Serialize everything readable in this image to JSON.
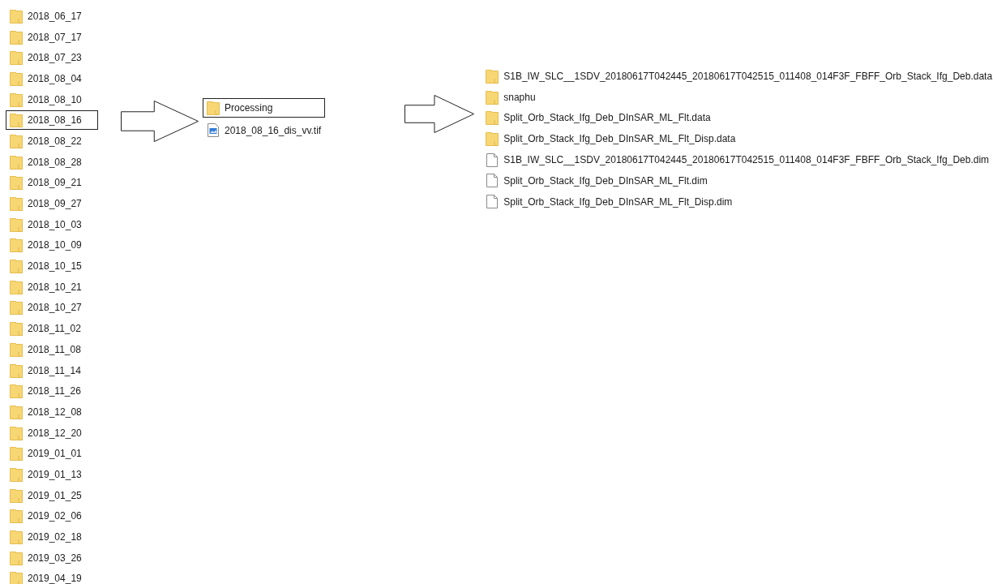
{
  "panes": [
    {
      "items": [
        {
          "name": "2018_06_17",
          "kind": "folder",
          "selected": false
        },
        {
          "name": "2018_07_17",
          "kind": "folder",
          "selected": false
        },
        {
          "name": "2018_07_23",
          "kind": "folder",
          "selected": false
        },
        {
          "name": "2018_08_04",
          "kind": "folder",
          "selected": false
        },
        {
          "name": "2018_08_10",
          "kind": "folder",
          "selected": false
        },
        {
          "name": "2018_08_16",
          "kind": "folder",
          "selected": true
        },
        {
          "name": "2018_08_22",
          "kind": "folder",
          "selected": false
        },
        {
          "name": "2018_08_28",
          "kind": "folder",
          "selected": false
        },
        {
          "name": "2018_09_21",
          "kind": "folder",
          "selected": false
        },
        {
          "name": "2018_09_27",
          "kind": "folder",
          "selected": false
        },
        {
          "name": "2018_10_03",
          "kind": "folder",
          "selected": false
        },
        {
          "name": "2018_10_09",
          "kind": "folder",
          "selected": false
        },
        {
          "name": "2018_10_15",
          "kind": "folder",
          "selected": false
        },
        {
          "name": "2018_10_21",
          "kind": "folder",
          "selected": false
        },
        {
          "name": "2018_10_27",
          "kind": "folder",
          "selected": false
        },
        {
          "name": "2018_11_02",
          "kind": "folder",
          "selected": false
        },
        {
          "name": "2018_11_08",
          "kind": "folder",
          "selected": false
        },
        {
          "name": "2018_11_14",
          "kind": "folder",
          "selected": false
        },
        {
          "name": "2018_11_26",
          "kind": "folder",
          "selected": false
        },
        {
          "name": "2018_12_08",
          "kind": "folder",
          "selected": false
        },
        {
          "name": "2018_12_20",
          "kind": "folder",
          "selected": false
        },
        {
          "name": "2019_01_01",
          "kind": "folder",
          "selected": false
        },
        {
          "name": "2019_01_13",
          "kind": "folder",
          "selected": false
        },
        {
          "name": "2019_01_25",
          "kind": "folder",
          "selected": false
        },
        {
          "name": "2019_02_06",
          "kind": "folder",
          "selected": false
        },
        {
          "name": "2019_02_18",
          "kind": "folder",
          "selected": false
        },
        {
          "name": "2019_03_26",
          "kind": "folder",
          "selected": false
        },
        {
          "name": "2019_04_19",
          "kind": "folder",
          "selected": false
        }
      ]
    },
    {
      "items": [
        {
          "name": "Processing",
          "kind": "folder",
          "selected": true
        },
        {
          "name": "2018_08_16_dis_vv.tif",
          "kind": "image",
          "selected": false
        }
      ]
    },
    {
      "items": [
        {
          "name": "S1B_IW_SLC__1SDV_20180617T042445_20180617T042515_011408_014F3F_FBFF_Orb_Stack_Ifg_Deb.data",
          "kind": "folder",
          "selected": false
        },
        {
          "name": "snaphu",
          "kind": "folder",
          "selected": false
        },
        {
          "name": "Split_Orb_Stack_Ifg_Deb_DInSAR_ML_Flt.data",
          "kind": "folder",
          "selected": false
        },
        {
          "name": "Split_Orb_Stack_Ifg_Deb_DInSAR_ML_Flt_Disp.data",
          "kind": "folder",
          "selected": false
        },
        {
          "name": "S1B_IW_SLC__1SDV_20180617T042445_20180617T042515_011408_014F3F_FBFF_Orb_Stack_Ifg_Deb.dim",
          "kind": "file",
          "selected": false
        },
        {
          "name": "Split_Orb_Stack_Ifg_Deb_DInSAR_ML_Flt.dim",
          "kind": "file",
          "selected": false
        },
        {
          "name": "Split_Orb_Stack_Ifg_Deb_DInSAR_ML_Flt_Disp.dim",
          "kind": "file",
          "selected": false
        }
      ]
    }
  ]
}
